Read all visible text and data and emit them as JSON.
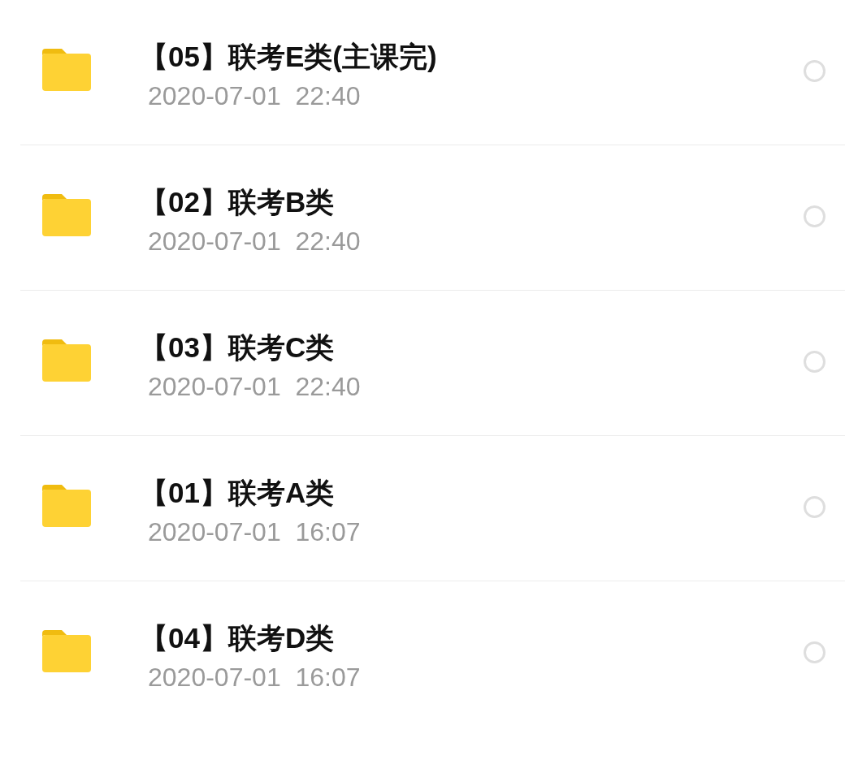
{
  "files": [
    {
      "name": "【05】联考E类(主课完)",
      "modified": "2020-07-01  22:40",
      "selected": false
    },
    {
      "name": "【02】联考B类",
      "modified": "2020-07-01  22:40",
      "selected": false
    },
    {
      "name": "【03】联考C类",
      "modified": "2020-07-01  22:40",
      "selected": false
    },
    {
      "name": "【01】联考A类",
      "modified": "2020-07-01  16:07",
      "selected": false
    },
    {
      "name": "【04】联考D类",
      "modified": "2020-07-01  16:07",
      "selected": false
    }
  ]
}
